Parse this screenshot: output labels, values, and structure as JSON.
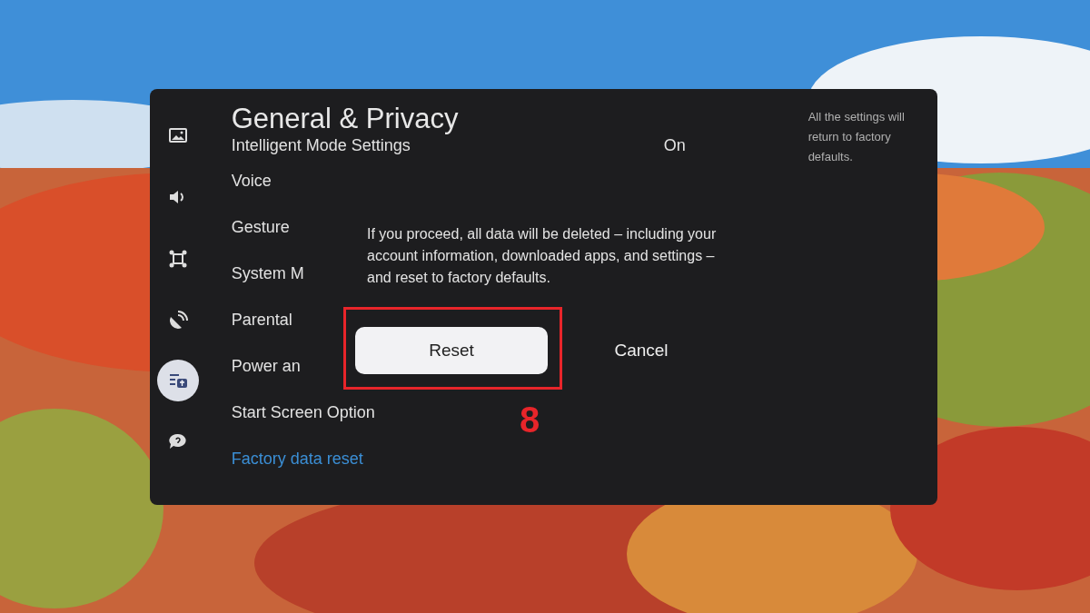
{
  "sidebar": {
    "items": [
      {
        "kind": "picture",
        "selected": false
      },
      {
        "kind": "sound",
        "selected": false
      },
      {
        "kind": "connection",
        "selected": false
      },
      {
        "kind": "broadcast",
        "selected": false
      },
      {
        "kind": "general",
        "selected": true
      },
      {
        "kind": "support",
        "selected": false
      }
    ]
  },
  "title": "General & Privacy",
  "settings": [
    {
      "label": "Intelligent Mode Settings",
      "value": "On",
      "selected": false
    },
    {
      "label": "Voice",
      "selected": false
    },
    {
      "label": "Gesture",
      "selected": false
    },
    {
      "label": "System M",
      "selected": false
    },
    {
      "label": "Parental",
      "selected": false
    },
    {
      "label": "Power an",
      "selected": false
    },
    {
      "label": "Start Screen Option",
      "selected": false
    },
    {
      "label": "Factory data reset",
      "selected": true
    }
  ],
  "info": "All the settings will return to factory defaults.",
  "dialog": {
    "message": "If you proceed, all data will be deleted – including your account information, downloaded apps, and settings – and reset to factory defaults.",
    "buttons": [
      {
        "label": "Reset",
        "selected": true
      },
      {
        "label": "Cancel",
        "selected": false
      }
    ]
  },
  "annotation": {
    "step": "8"
  }
}
